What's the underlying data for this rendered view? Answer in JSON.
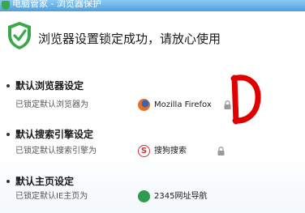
{
  "window": {
    "title": "电脑管家 - 浏览器保护"
  },
  "headline": "浏览器设置锁定成功，请放心使用",
  "items": [
    {
      "title": "默认浏览器设定",
      "desc": "已锁定默认浏览器为",
      "app_name": "Mozilla Firefox",
      "app_icon": "firefox-icon",
      "locked": true
    },
    {
      "title": "默认搜索引擎设定",
      "desc": "已锁定默认搜索引擎为",
      "app_name": "搜狗搜索",
      "app_icon": "sogou-icon",
      "app_icon_glyph": "S",
      "locked": true
    },
    {
      "title": "默认主页设定",
      "desc": "已锁定默认IE主页为",
      "app_name": "2345网址导航",
      "app_icon": "nav-icon",
      "locked": false
    }
  ],
  "colors": {
    "titlebar": "#4c9fdc",
    "shield": "#3aa84a",
    "annotation": "#e00000",
    "lock": "#9a9a9a"
  }
}
